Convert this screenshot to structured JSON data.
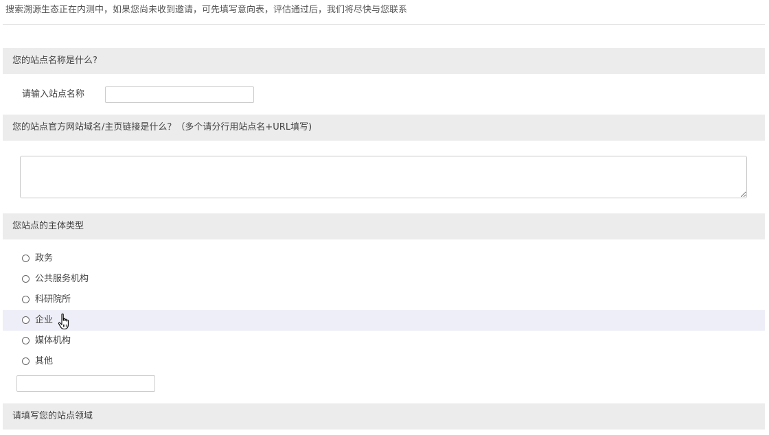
{
  "notice": "搜索溯源生态正在内测中，如果您尚未收到邀请，可先填写意向表，评估通过后，我们将尽快与您联系",
  "q1": {
    "title": "您的站点名称是什么?",
    "field_label": "请输入站点名称",
    "value": ""
  },
  "q2": {
    "title": "您的站点官方网站域名/主页链接是什么？（多个请分行用站点名+URL填写)",
    "value": ""
  },
  "q3": {
    "title": "您站点的主体类型",
    "options": [
      "政务",
      "公共服务机构",
      "科研院所",
      "企业",
      "媒体机构",
      "其他"
    ],
    "hovered_option": "企业",
    "other_value": ""
  },
  "q4": {
    "title": "请填写您的站点领域"
  },
  "colors": {
    "section_header_bg": "#ececec",
    "hover_row_bg": "#eeeef8",
    "divider": "#e2e2e2"
  },
  "icons": {
    "cursor": "hand-pointer-icon"
  }
}
